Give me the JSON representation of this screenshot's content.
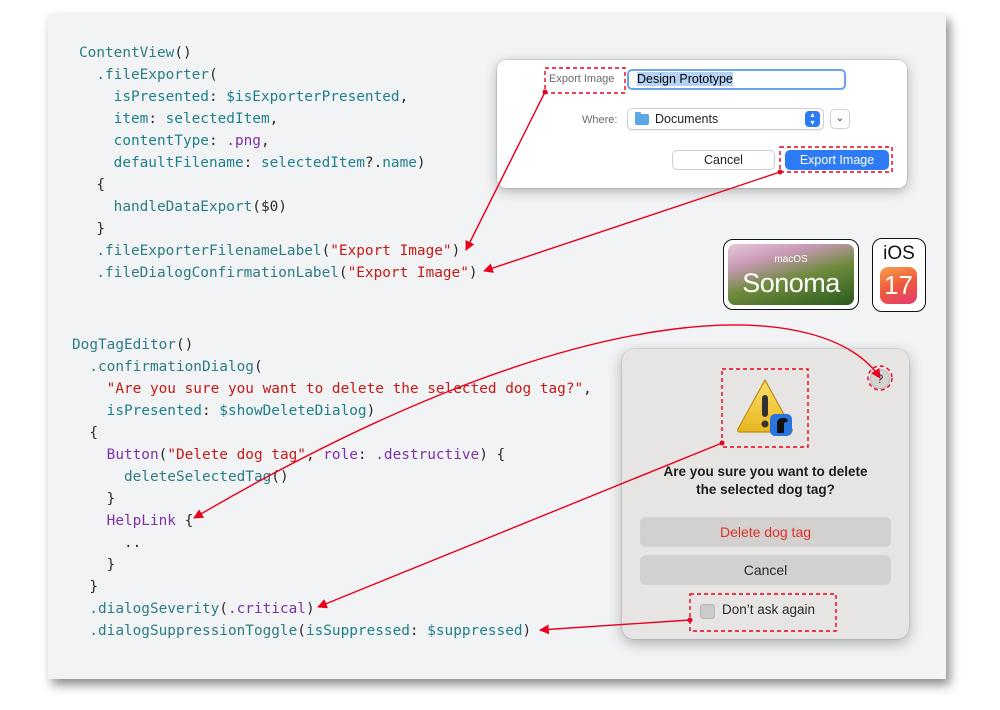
{
  "code_top": {
    "line1": {
      "fn": "ContentView",
      "rest": "()"
    },
    "line2": {
      "fn": ".fileExporter",
      "rest": "("
    },
    "line3": {
      "param": "isPresented",
      "sep": ": ",
      "value": "$isExporterPresented",
      "rest": ","
    },
    "line4": {
      "param": "item",
      "sep": ": ",
      "value": "selectedItem",
      "rest": ","
    },
    "line5": {
      "param": "contentType",
      "sep": ": ",
      "value": ".png",
      "rest": ","
    },
    "line6": {
      "param": "defaultFilename",
      "sep": ": ",
      "value": "selectedItem",
      "rest2": "?.",
      "value2": "name",
      "rest": ")"
    },
    "line7": "{",
    "line8": {
      "fn": "handleDataExport",
      "rest": "($0)"
    },
    "line9": "}",
    "line10": {
      "fn": ".fileExporterFilenameLabel",
      "open": "(",
      "str": "\"Export Image\"",
      "close": ")"
    },
    "line11": {
      "fn": ".fileDialogConfirmationLabel",
      "open": "(",
      "str": "\"Export Image\"",
      "close": ")"
    }
  },
  "code_bottom": {
    "line1": {
      "fn": "DogTagEditor",
      "rest": "()"
    },
    "line2": {
      "fn": ".confirmationDialog",
      "rest": "("
    },
    "line3": {
      "str": "\"Are you sure you want to delete the selected dog tag?\"",
      "rest": ","
    },
    "line4": {
      "param": "isPresented",
      "sep": ": ",
      "value": "$showDeleteDialog",
      "rest": ")"
    },
    "line5": "{",
    "line6": {
      "kw": "Button",
      "open": "(",
      "str": "\"Delete dog tag\"",
      "mid": ", ",
      "kw2": "role",
      "sep": ": ",
      "value": ".destructive",
      "rest": ") {"
    },
    "line7": {
      "fn": "deleteSelectedTag",
      "rest": "()"
    },
    "line8": "}",
    "line9": {
      "kw": "HelpLink",
      "rest": " {"
    },
    "line10": "..",
    "line11": "}",
    "line12": "}",
    "line13": {
      "fn": ".dialogSeverity",
      "open": "(",
      "value": ".critical",
      "close": ")"
    },
    "line14": {
      "fn": ".dialogSuppressionToggle",
      "open": "(",
      "param": "isSuppressed",
      "sep": ": ",
      "value": "$suppressed",
      "close": ")"
    }
  },
  "export_dialog": {
    "filename_label": "Export Image",
    "filename_value": "Design Prototype",
    "where_label": "Where:",
    "where_value": "Documents",
    "cancel_label": "Cancel",
    "confirm_label": "Export Image",
    "folder_icon": "folder-icon",
    "stepper_icon": "up-down-chevron-icon",
    "expand_icon": "chevron-down-icon"
  },
  "confirm_dialog": {
    "title_line1": "Are you sure you want to delete",
    "title_line2": "the selected dog tag?",
    "help": "?",
    "delete_label": "Delete dog tag",
    "cancel_label": "Cancel",
    "suppress_label": "Don’t ask again",
    "warning_icon": "warning-triangle-icon"
  },
  "badges": {
    "macos_small": "macOS",
    "macos_name": "Sonoma",
    "ios_label": "iOS",
    "ios_number": "17"
  },
  "colors": {
    "accent": "#2d7cf6",
    "annotation": "#e8001c",
    "destructive": "#e0302a",
    "keyword": "#7e2fa8",
    "function": "#2c7c86",
    "string": "#c41a16"
  }
}
